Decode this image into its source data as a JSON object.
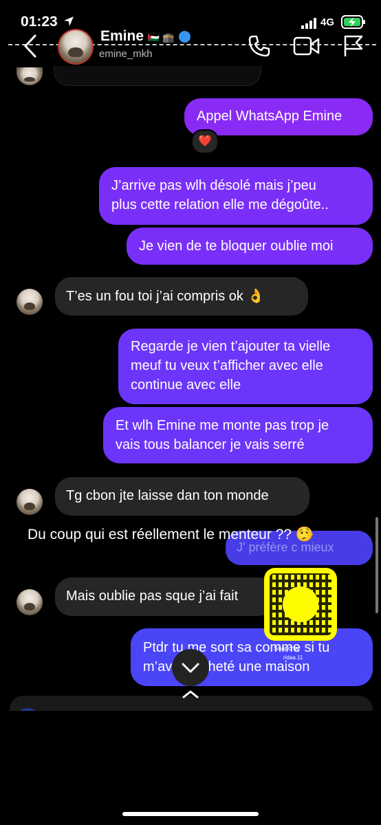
{
  "status_bar": {
    "time": "01:23",
    "network": "4G"
  },
  "header": {
    "name": "Emine",
    "name_suffix": "🇵🇸 🕋",
    "username": "emine_mkh"
  },
  "messages": [
    {
      "direction": "out",
      "text": "Appel WhatsApp Emine",
      "reaction": "❤️"
    },
    {
      "direction": "out",
      "text": "J’arrive pas wlh désolé mais j’peu\nplus cette relation elle me dégoûte.."
    },
    {
      "direction": "out",
      "text": "Je vien de te bloquer oublie moi"
    },
    {
      "direction": "in",
      "text": "T’es un fou toi j’ai compris ok 👌"
    },
    {
      "direction": "out",
      "text": "Regarde je vien t’ajouter ta vielle\nmeuf tu veux t’afficher avec elle\ncontinue avec elle"
    },
    {
      "direction": "out",
      "text": "Et wlh Emine me monte pas trop je\nvais tous balancer je vais serré"
    },
    {
      "direction": "in",
      "text": "Tg cbon jte laisse dan ton monde"
    },
    {
      "direction": "out",
      "text": "J' préfère c mieux"
    },
    {
      "direction": "in",
      "text": "Mais oublie pas sque j’ai fait"
    },
    {
      "direction": "out",
      "text": "Ptdr tu me sort sa comme si tu\nm’avais acheté une maison"
    }
  ],
  "overlay_caption": "Du coup qui est réellement le menteur ?? 🤥",
  "snapcode": {
    "label": "Snapchat",
    "username": "ridaa.11"
  },
  "colors": {
    "accent": "#6a32ff",
    "incoming": "#262626",
    "snap": "#fffc00"
  }
}
